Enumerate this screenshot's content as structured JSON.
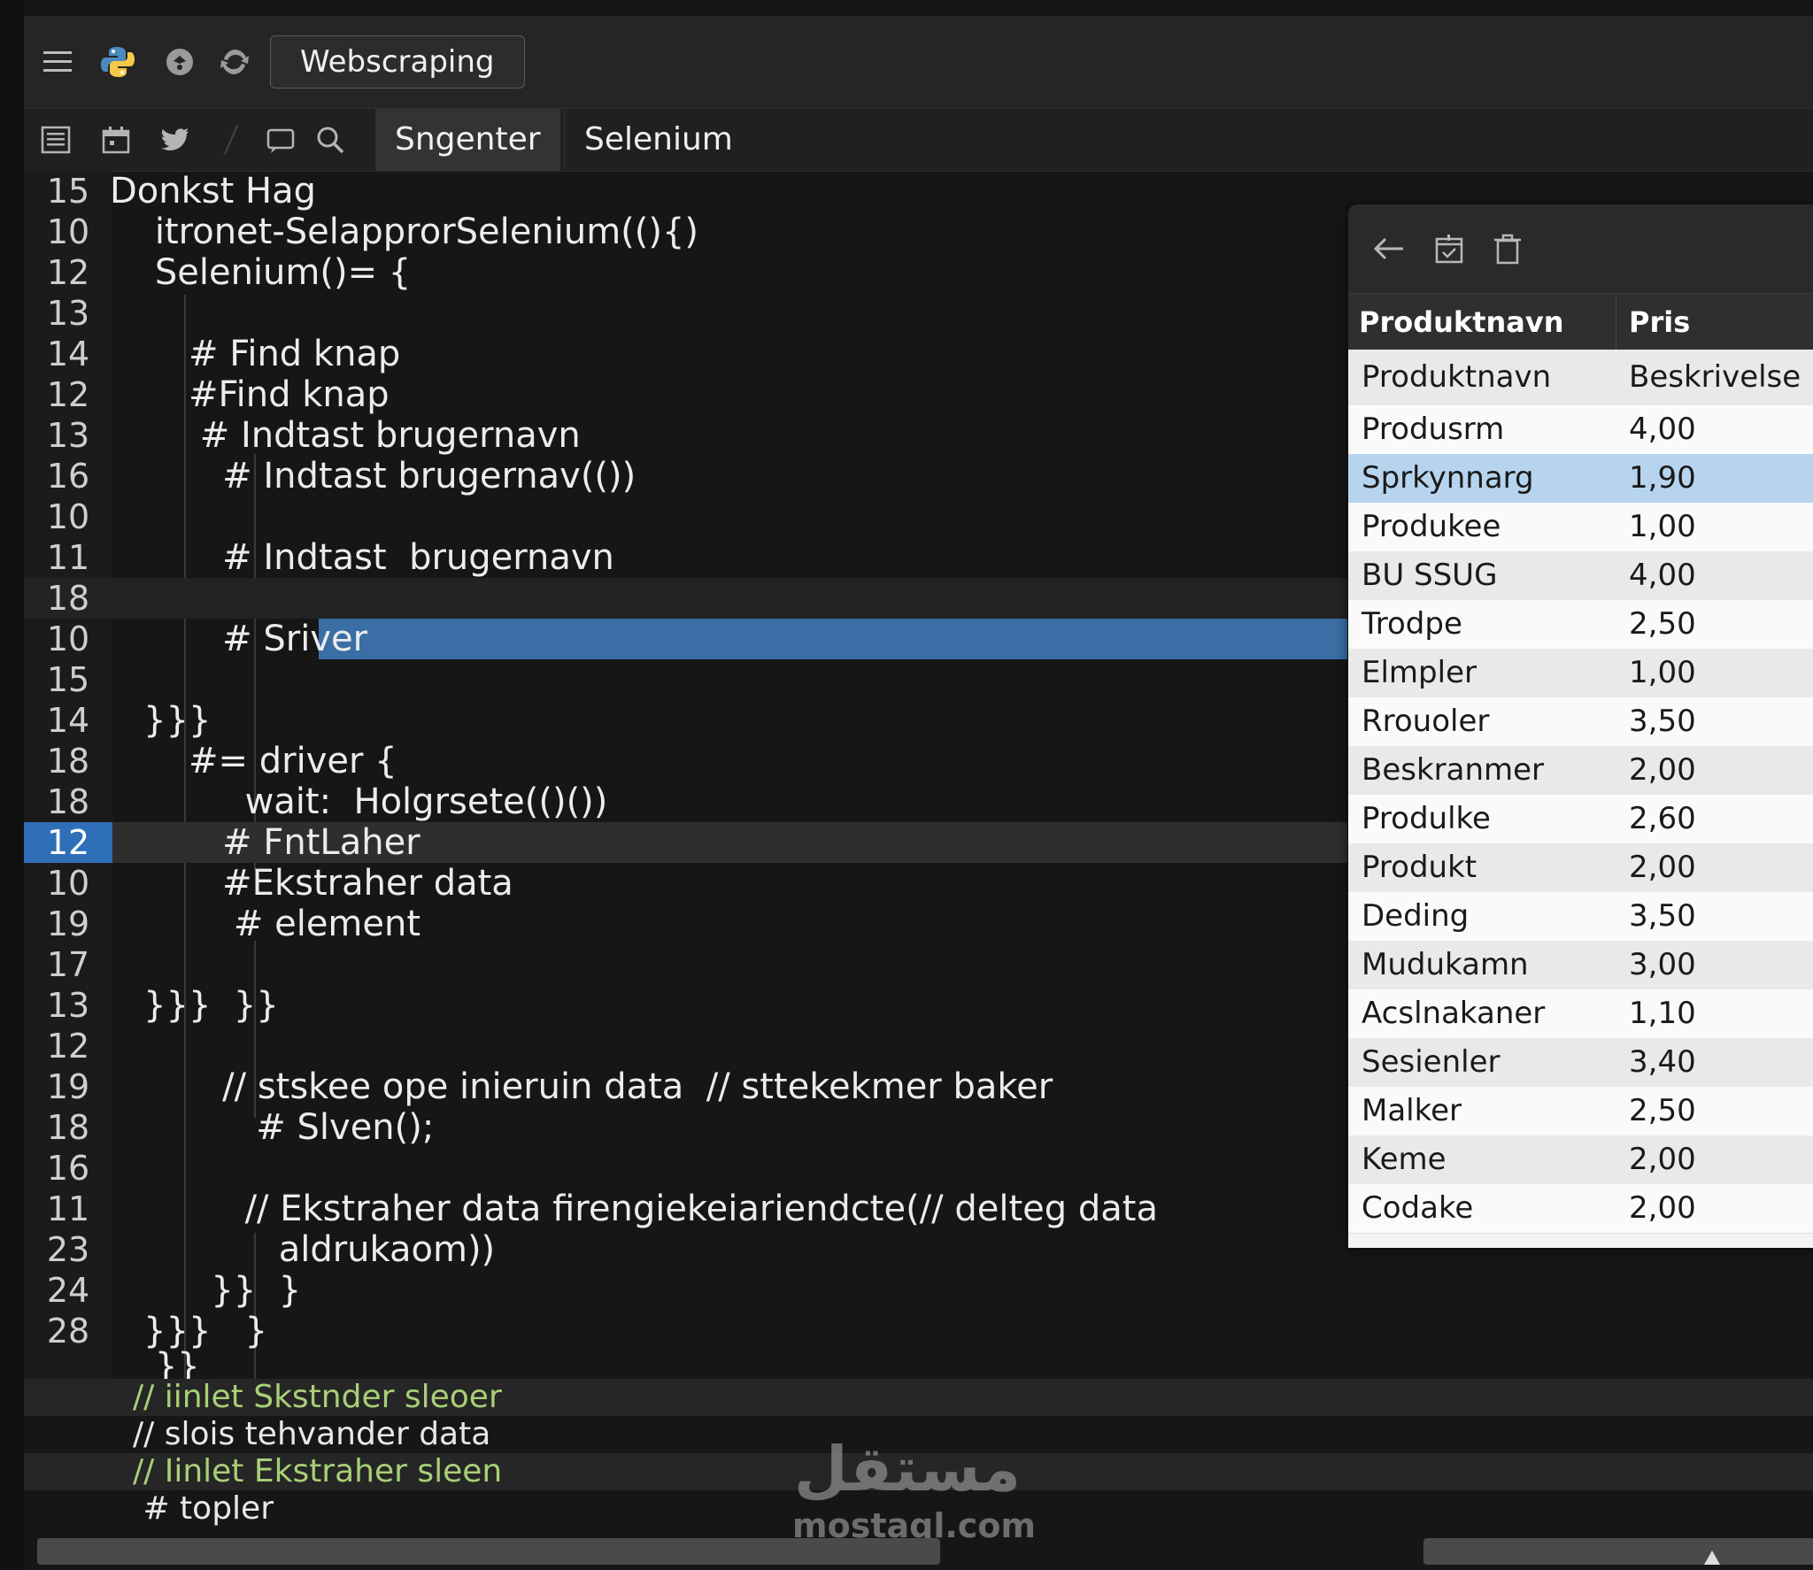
{
  "window": {
    "title": "Webscraping"
  },
  "toolbar": {
    "tabs": [
      {
        "label": "Sngenter"
      },
      {
        "label": "Selenium"
      }
    ]
  },
  "editor": {
    "lines": [
      {
        "n": "15",
        "text": "Donkst Hag"
      },
      {
        "n": "10",
        "text": "    itronet-SelapprorSelenium((){)"
      },
      {
        "n": "12",
        "text": "    Selenium()= {"
      },
      {
        "n": "13",
        "text": ""
      },
      {
        "n": "14",
        "text": "       # Find knap"
      },
      {
        "n": "12",
        "text": "       #Find knap"
      },
      {
        "n": "13",
        "text": "        # Indtast brugernavn"
      },
      {
        "n": "16",
        "text": "          # Indtast brugernav(())"
      },
      {
        "n": "10",
        "text": ""
      },
      {
        "n": "11",
        "text": "          # Indtast  brugernavn"
      },
      {
        "n": "18",
        "text": ""
      },
      {
        "n": "10",
        "text": "          # Sriver"
      },
      {
        "n": "15",
        "text": ""
      },
      {
        "n": "14",
        "text": "   }}}"
      },
      {
        "n": "18",
        "text": "       #= driver {"
      },
      {
        "n": "18",
        "text": "            wait:  Holgrsete(()())"
      },
      {
        "n": "12",
        "text": "          # FntLaher"
      },
      {
        "n": "10",
        "text": "          #Ekstraher data"
      },
      {
        "n": "19",
        "text": "           # element"
      },
      {
        "n": "17",
        "text": ""
      },
      {
        "n": "13",
        "text": "   }}}  }}"
      },
      {
        "n": "12",
        "text": ""
      },
      {
        "n": "19",
        "text": "          // stskee ope inieruin data  // sttekekmer baker"
      },
      {
        "n": "18",
        "text": "             # Slven();"
      },
      {
        "n": "16",
        "text": ""
      },
      {
        "n": "11",
        "text": "            // Ekstraher data firengiekeiariendcte(// delteg data"
      },
      {
        "n": "23",
        "text": "               aldrukaom))"
      },
      {
        "n": "24",
        "text": "         }}  }"
      },
      {
        "n": "28",
        "text": "   }}}   }"
      }
    ],
    "tail_line": "    }}",
    "bottom_lines": [
      {
        "text": "// iinlet Skstnder sleoer"
      },
      {
        "text": "// slois tehvander data"
      },
      {
        "text": "// Iinlet Ekstraher sleen"
      },
      {
        "text": " # topler"
      }
    ]
  },
  "panel": {
    "header": {
      "col1": "Produktnavn",
      "col2": "Pris"
    },
    "rows": [
      {
        "name": "Produktnavn",
        "price": "Beskrivelse"
      },
      {
        "name": "Produsrm",
        "price": "4,00"
      },
      {
        "name": "Sprkynnarg",
        "price": "1,90"
      },
      {
        "name": "Produkee",
        "price": "1,00"
      },
      {
        "name": "BU SSUG",
        "price": "4,00"
      },
      {
        "name": "Trodpe",
        "price": "2,50"
      },
      {
        "name": "Elmpler",
        "price": "1,00"
      },
      {
        "name": "Rrouoler",
        "price": "3,50"
      },
      {
        "name": "Beskranmer",
        "price": "2,00"
      },
      {
        "name": "Produlke",
        "price": "2,60"
      },
      {
        "name": "Produkt",
        "price": "2,00"
      },
      {
        "name": "Deding",
        "price": "3,50"
      },
      {
        "name": "Mudukamn",
        "price": "3,00"
      },
      {
        "name": "Acslnakaner",
        "price": "1,10"
      },
      {
        "name": "Sesienler",
        "price": "3,40"
      },
      {
        "name": "Malker",
        "price": "2,50"
      },
      {
        "name": "Keme",
        "price": "2,00"
      },
      {
        "name": "Codake",
        "price": "2,00"
      }
    ]
  },
  "watermark": {
    "logo": "مستقل",
    "domain": "mostaql.com"
  },
  "icons": {
    "topbar": [
      "menu-icon",
      "python-icon",
      "bug-icon",
      "sync-icon"
    ],
    "toolbar": [
      "file-list-icon",
      "calendar-icon",
      "bird-icon",
      "comment-icon",
      "search-icon"
    ],
    "panel": [
      "back-arrow-icon",
      "calendar-check-icon",
      "trash-icon"
    ]
  },
  "colors": {
    "selection": "#3a6ea5",
    "current_line_number": "#2f6fb8",
    "comment": "#a9cf77",
    "row_selected": "#b7d4ef"
  }
}
